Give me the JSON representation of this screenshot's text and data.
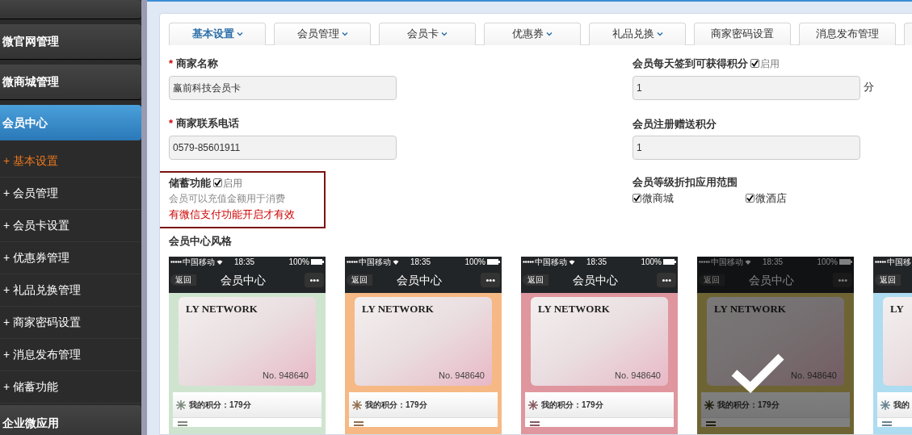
{
  "sidebar": {
    "groups_before": [
      {
        "label": "微官网管理"
      },
      {
        "label": "微商城管理"
      }
    ],
    "active_group": {
      "label": "会员中心",
      "selected": true
    },
    "items": [
      {
        "label": "+ 基本设置",
        "selected": true
      },
      {
        "label": "+ 会员管理",
        "selected": false
      },
      {
        "label": "+ 会员卡设置",
        "selected": false
      },
      {
        "label": "+ 优惠券管理",
        "selected": false
      },
      {
        "label": "+ 礼品兑换管理",
        "selected": false
      },
      {
        "label": "+ 商家密码设置",
        "selected": false
      },
      {
        "label": "+ 消息发布管理",
        "selected": false
      },
      {
        "label": "+ 储蓄功能",
        "selected": false
      }
    ],
    "groups_after": [
      {
        "label": "企业微应用"
      }
    ]
  },
  "tabs": [
    {
      "label": "基本设置",
      "dropdown": true,
      "selected": true
    },
    {
      "label": "会员管理",
      "dropdown": true,
      "selected": false
    },
    {
      "label": "会员卡",
      "dropdown": true,
      "selected": false
    },
    {
      "label": "优惠券",
      "dropdown": true,
      "selected": false
    },
    {
      "label": "礼品兑换",
      "dropdown": true,
      "selected": false
    },
    {
      "label": "商家密码设置",
      "dropdown": false,
      "selected": false
    },
    {
      "label": "消息发布管理",
      "dropdown": false,
      "selected": false
    }
  ],
  "form": {
    "merchant_name": {
      "required_mark": "*",
      "label": "商家名称",
      "value": "赢前科技会员卡"
    },
    "merchant_phone": {
      "required_mark": "*",
      "label": "商家联系电话",
      "value": "0579-85601911"
    },
    "storage": {
      "label": "储蓄功能",
      "checkbox_label": "启用",
      "checked": true,
      "hint": "会员可以充值金额用于消费",
      "warning": "有微信支付功能开启才有效"
    },
    "daily_points": {
      "label": "会员每天签到可获得积分",
      "checkbox_label": "启用",
      "checked": true,
      "value": "1",
      "unit": "分"
    },
    "register_points": {
      "label": "会员注册赠送积分",
      "value": "1"
    },
    "discount_scope": {
      "label": "会员等级折扣应用范围",
      "options": [
        {
          "label": "微商城",
          "checked": true
        },
        {
          "label": "微酒店",
          "checked": true
        }
      ]
    },
    "style_label": "会员中心风格"
  },
  "themes": [
    {
      "color": "#cfe4cf",
      "selected": false,
      "carrier": "中国移动",
      "time": "18:35",
      "battery": "100%",
      "back": "返回",
      "title": "会员中心",
      "more": "•••",
      "card_title": "LY NETWORK",
      "card_no": "No. 948640",
      "points": "我的积分：179分"
    },
    {
      "color": "#f6b985",
      "selected": false,
      "carrier": "中国移动",
      "time": "18:35",
      "battery": "100%",
      "back": "返回",
      "title": "会员中心",
      "more": "•••",
      "card_title": "LY NETWORK",
      "card_no": "No. 948640",
      "points": "我的积分：179分"
    },
    {
      "color": "#e0969e",
      "selected": false,
      "carrier": "中国移动",
      "time": "18:35",
      "battery": "100%",
      "back": "返回",
      "title": "会员中心",
      "more": "•••",
      "card_title": "LY NETWORK",
      "card_no": "No. 948640",
      "points": "我的积分：179分"
    },
    {
      "color": "#6e6433",
      "selected": true,
      "carrier": "中国移动",
      "time": "18:35",
      "battery": "100%",
      "back": "返回",
      "title": "会员中心",
      "more": "•••",
      "card_title": "LY NETWORK",
      "card_no": "No. 948640",
      "points": "我的积分：179分"
    },
    {
      "color": "#aedcf0",
      "selected": false,
      "carrier": "中国移",
      "back": "返回",
      "card_title": "LY",
      "points": "我的"
    }
  ]
}
